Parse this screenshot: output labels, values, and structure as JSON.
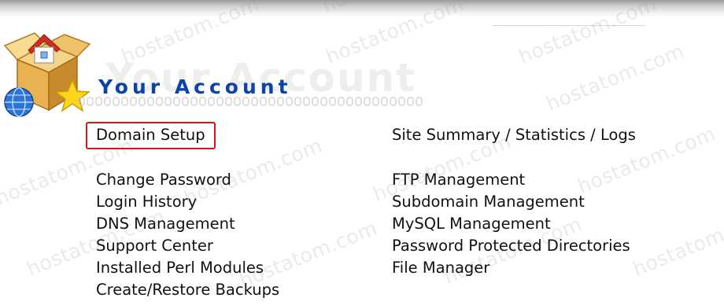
{
  "header": {
    "title": "Your Account",
    "ghost_title": "Your Account",
    "logo_icon": "house-box-globe-star-icon",
    "title_color": "#0a44a8"
  },
  "watermark": {
    "text": "hostatom.com"
  },
  "left_links": [
    "Domain Setup",
    "Change Password",
    "Login History",
    "DNS Management",
    "Support Center",
    "Installed Perl Modules",
    "Create/Restore Backups"
  ],
  "right_links": [
    "Site Summary / Statistics / Logs",
    "FTP Management",
    "Subdomain Management",
    "MySQL Management",
    "Password Protected Directories",
    "File Manager"
  ],
  "highlighted_link": "Domain Setup",
  "highlight_color": "#d01818"
}
